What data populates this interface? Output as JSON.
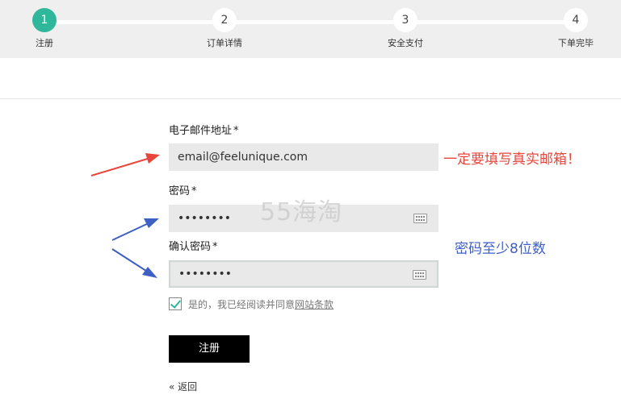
{
  "stepper": {
    "steps": [
      {
        "number": "1",
        "label": "注册"
      },
      {
        "number": "2",
        "label": "订单详情"
      },
      {
        "number": "3",
        "label": "安全支付"
      },
      {
        "number": "4",
        "label": "下单完毕"
      }
    ],
    "active_step": "1"
  },
  "form": {
    "email_label": "电子邮件地址",
    "email_value": "email@feelunique.com",
    "password_label": "密码",
    "password_value": "••••••••",
    "confirm_label": "确认密码",
    "confirm_value": "••••••••",
    "required_mark": "*",
    "agree_text": "是的，我已经阅读并同意",
    "terms_link": "网站条款",
    "agree_checked": true,
    "submit_label": "注册",
    "back_label": "« 返回"
  },
  "annotations": {
    "email_note": "一定要填写真实邮箱！",
    "password_note": "密码至少8位数",
    "watermark": "55海淘",
    "red_color": "#e8453c",
    "blue_color": "#3e5fc6"
  },
  "colors": {
    "accent": "#2fb79b",
    "button": "#000000"
  }
}
